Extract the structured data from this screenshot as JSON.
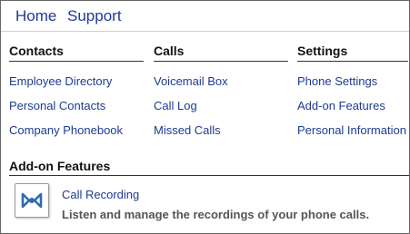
{
  "topnav": {
    "home_label": "Home",
    "support_label": "Support"
  },
  "columns": {
    "contacts": {
      "header": "Contacts",
      "items": [
        "Employee Directory",
        "Personal Contacts",
        "Company Phonebook"
      ]
    },
    "calls": {
      "header": "Calls",
      "items": [
        "Voicemail Box",
        "Call Log",
        "Missed Calls"
      ]
    },
    "settings": {
      "header": "Settings",
      "items": [
        "Phone Settings",
        "Add-on Features",
        "Personal Information"
      ]
    }
  },
  "addons": {
    "header": "Add-on Features",
    "feature": {
      "title": "Call Recording",
      "description": "Listen and manage the recordings of your phone calls.",
      "icon": "call-recording-icon"
    }
  },
  "colors": {
    "link": "#1f3a93",
    "header_text": "#111111",
    "description_text": "#555555",
    "icon_accent": "#2b6cb0"
  }
}
